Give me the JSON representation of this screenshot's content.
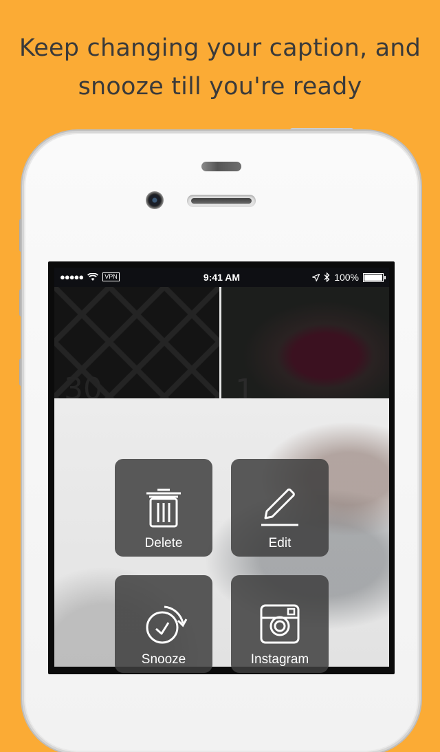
{
  "promo": {
    "line1": "Keep changing your caption, and",
    "line2": "snooze till you're ready"
  },
  "status_bar": {
    "signal": "●●●●●",
    "vpn": "VPN",
    "time": "9:41 AM",
    "battery": "100%"
  },
  "tiles": [
    {
      "overlay_text": "30"
    },
    {
      "overlay_text": "1"
    }
  ],
  "actions": {
    "delete": "Delete",
    "edit": "Edit",
    "snooze": "Snooze",
    "instagram": "Instagram"
  },
  "colors": {
    "background": "#fbab35",
    "headline_text": "#3a3a3a",
    "action_tile": "#3e3e3e"
  }
}
